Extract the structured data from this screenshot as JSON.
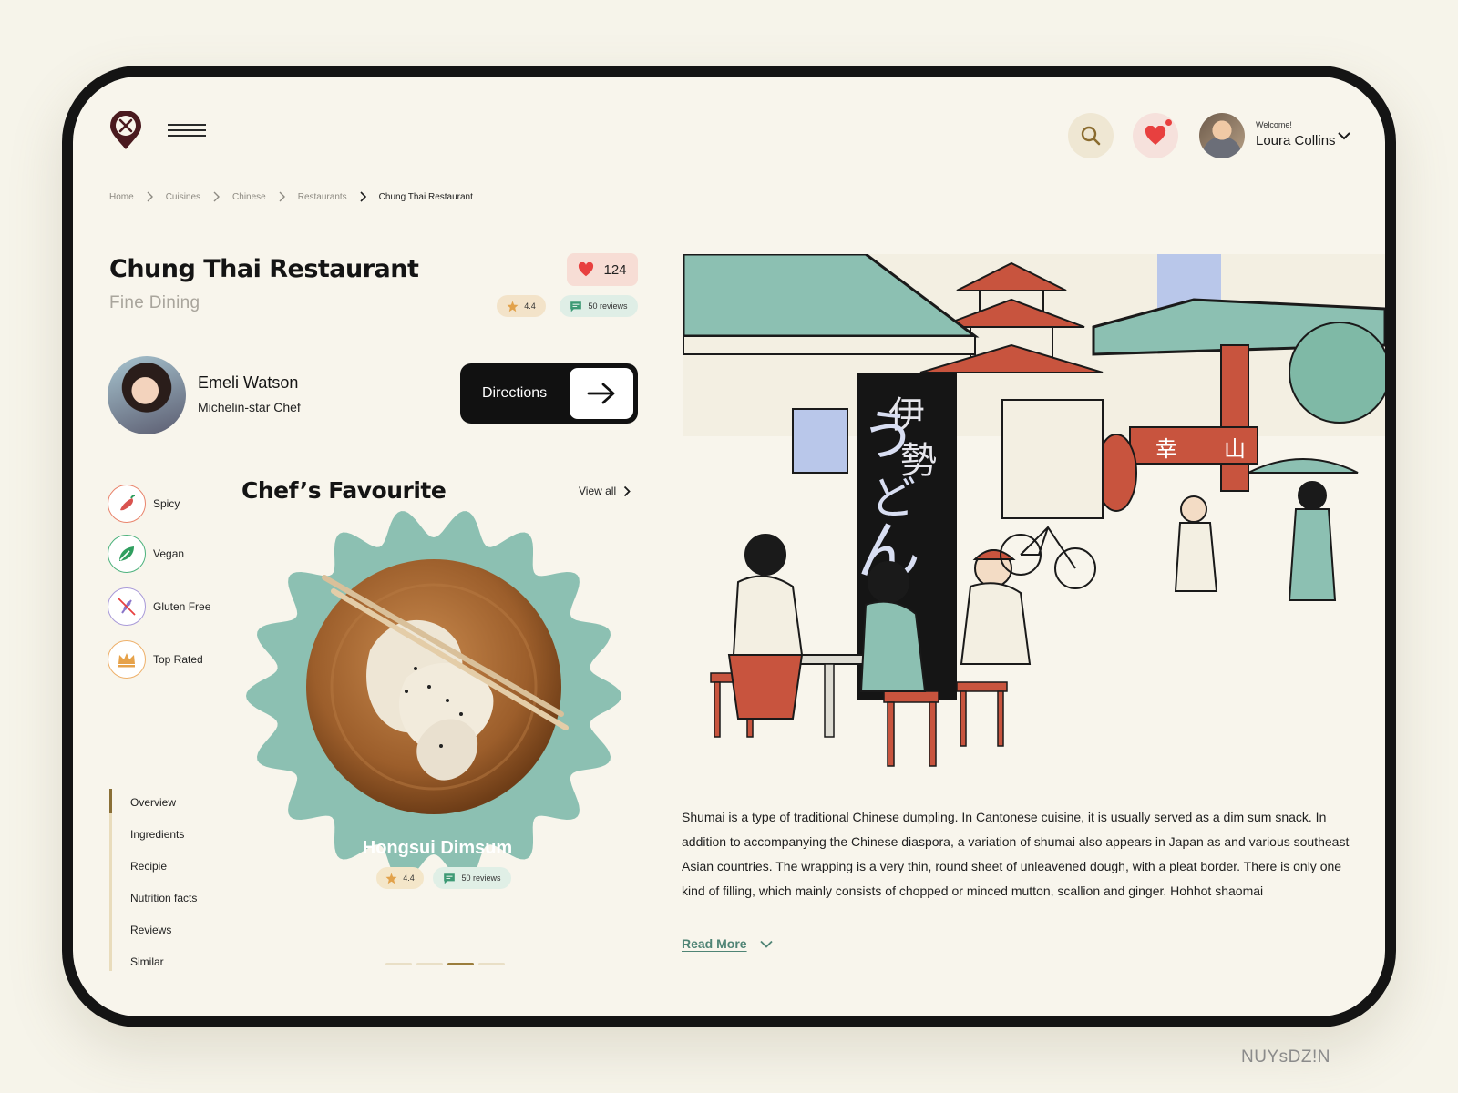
{
  "header": {
    "welcome": "Welcome!",
    "username": "Loura Collins"
  },
  "breadcrumb": [
    "Home",
    "Cuisines",
    "Chinese",
    "Restaurants",
    "Chung Thai Restaurant"
  ],
  "restaurant": {
    "name": "Chung Thai Restaurant",
    "category": "Fine Dining",
    "likes": "124",
    "rating": "4.4",
    "reviews": "50 reviews"
  },
  "chef": {
    "name": "Emeli Watson",
    "role": "Michelin-star Chef"
  },
  "directions_label": "Directions",
  "filters": [
    {
      "label": "Spicy",
      "icon": "chili-icon",
      "color": "#d9534f"
    },
    {
      "label": "Vegan",
      "icon": "leaf-icon",
      "color": "#2f9e5f"
    },
    {
      "label": "Gluten Free",
      "icon": "wheat-crossed-icon",
      "color": "#8a76c9"
    },
    {
      "label": "Top Rated",
      "icon": "crown-icon",
      "color": "#e6a24a"
    }
  ],
  "favourite": {
    "title": "Chef’s Favourite",
    "view_all": "View all",
    "dish_name": "Hongsui Dimsum",
    "rating": "4.4",
    "reviews": "50 reviews",
    "carousel_pages": 4,
    "carousel_active": 3
  },
  "side_nav": [
    "Overview",
    "Ingredients",
    "Recipie",
    "Nutrition facts",
    "Reviews",
    "Similar"
  ],
  "description": "Shumai is a type of traditional Chinese dumpling. In Cantonese cuisine, it is usually served as a dim sum snack. In addition to accompanying the Chinese diaspora, a variation of shumai also appears in Japan as and various southeast Asian countries. The wrapping is a very thin, round sheet of unleavened dough, with a pleat border. There is only one kind of filling, which mainly consists of chopped or minced mutton, scallion and ginger. Hohhot shaomai",
  "read_more": "Read More",
  "illustration_signs": [
    "伊",
    "勢",
    "う",
    "ど",
    "ん",
    "幸",
    "山"
  ],
  "watermark": "NUYsDZ!N",
  "colors": {
    "accent_teal": "#8cc0b2",
    "accent_red": "#e8403f",
    "dark": "#111111",
    "background": "#f8f5ec"
  }
}
